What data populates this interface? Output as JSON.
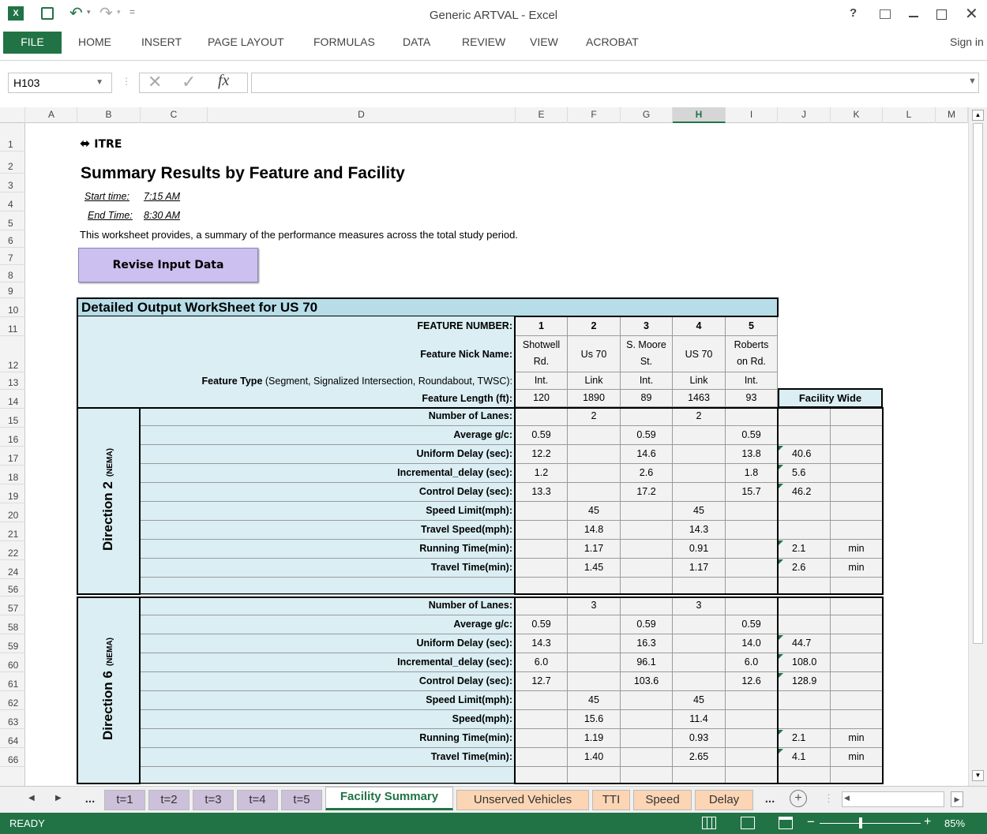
{
  "window": {
    "title": "Generic ARTVAL - Excel",
    "help": "?",
    "signin": "Sign in"
  },
  "ribbon": {
    "tabs": [
      "FILE",
      "HOME",
      "INSERT",
      "PAGE LAYOUT",
      "FORMULAS",
      "DATA",
      "REVIEW",
      "VIEW",
      "ACROBAT"
    ]
  },
  "formula_bar": {
    "cell_ref": "H103",
    "content": ""
  },
  "columns": [
    "A",
    "B",
    "C",
    "D",
    "E",
    "F",
    "G",
    "H",
    "I",
    "J",
    "K",
    "L",
    "M"
  ],
  "rows": [
    "1",
    "2",
    "3",
    "4",
    "5",
    "6",
    "7",
    "8",
    "9",
    "10",
    "11",
    "12",
    "13",
    "14",
    "15",
    "16",
    "17",
    "18",
    "19",
    "20",
    "21",
    "22",
    "24",
    "56",
    "57",
    "58",
    "59",
    "60",
    "61",
    "62",
    "63",
    "64",
    "66"
  ],
  "header": {
    "logo": "ITRE",
    "title": "Summary Results by Feature and Facility",
    "start_label": "Start time:",
    "start_value": "7:15 AM",
    "end_label": "End Time:",
    "end_value": "8:30 AM",
    "description": "This worksheet provides, a summary of the performance measures across the total study period.",
    "revise_button": "Revise Input Data"
  },
  "table": {
    "title": "Detailed Output WorkSheet for US 70",
    "feature_number_label": "FEATURE NUMBER:",
    "feature_numbers": [
      "1",
      "2",
      "3",
      "4",
      "5"
    ],
    "nick_label": "Feature Nick Name:",
    "nicks": [
      [
        "Shotwell",
        "Rd."
      ],
      [
        "Us 70",
        ""
      ],
      [
        "S. Moore",
        "St."
      ],
      [
        "US 70",
        ""
      ],
      [
        "Roberts",
        "on Rd."
      ]
    ],
    "type_label_bold": "Feature Type",
    "type_label_rest": " (Segment, Signalized Intersection, Roundabout, TWSC):",
    "types": [
      "Int.",
      "Link",
      "Int.",
      "Link",
      "Int."
    ],
    "length_label": "Feature Length (ft):",
    "lengths": [
      "120",
      "1890",
      "89",
      "1463",
      "93"
    ],
    "facility_wide": "Facility Wide",
    "dir2": {
      "label": "Direction 2",
      "sub": "(NEMA)",
      "rows": [
        {
          "label": "Number of Lanes:",
          "v": [
            "",
            "2",
            "",
            "2",
            ""
          ],
          "fw": "",
          "unit": ""
        },
        {
          "label": "Average g/c:",
          "v": [
            "0.59",
            "",
            "0.59",
            "",
            "0.59"
          ],
          "fw": "",
          "unit": ""
        },
        {
          "label": "Uniform Delay (sec):",
          "v": [
            "12.2",
            "",
            "14.6",
            "",
            "13.8"
          ],
          "fw": "40.6",
          "unit": ""
        },
        {
          "label": "Incremental_delay (sec):",
          "v": [
            "1.2",
            "",
            "2.6",
            "",
            "1.8"
          ],
          "fw": "5.6",
          "unit": ""
        },
        {
          "label": "Control Delay (sec):",
          "v": [
            "13.3",
            "",
            "17.2",
            "",
            "15.7"
          ],
          "fw": "46.2",
          "unit": ""
        },
        {
          "label": "Speed Limit(mph):",
          "v": [
            "",
            "45",
            "",
            "45",
            ""
          ],
          "fw": "",
          "unit": ""
        },
        {
          "label": "Travel Speed(mph):",
          "v": [
            "",
            "14.8",
            "",
            "14.3",
            ""
          ],
          "fw": "",
          "unit": ""
        },
        {
          "label": "Running Time(min):",
          "v": [
            "",
            "1.17",
            "",
            "0.91",
            ""
          ],
          "fw": "2.1",
          "unit": "min"
        },
        {
          "label": "Travel Time(min):",
          "v": [
            "",
            "1.45",
            "",
            "1.17",
            ""
          ],
          "fw": "2.6",
          "unit": "min"
        },
        {
          "label": "",
          "v": [
            "",
            "",
            "",
            "",
            ""
          ],
          "fw": "",
          "unit": ""
        }
      ]
    },
    "dir6": {
      "label": "Direction 6",
      "sub": "(NEMA)",
      "rows": [
        {
          "label": "Number of Lanes:",
          "v": [
            "",
            "3",
            "",
            "3",
            ""
          ],
          "fw": "",
          "unit": ""
        },
        {
          "label": "Average g/c:",
          "v": [
            "0.59",
            "",
            "0.59",
            "",
            "0.59"
          ],
          "fw": "",
          "unit": ""
        },
        {
          "label": "Uniform Delay (sec):",
          "v": [
            "14.3",
            "",
            "16.3",
            "",
            "14.0"
          ],
          "fw": "44.7",
          "unit": ""
        },
        {
          "label": "Incremental_delay (sec):",
          "v": [
            "6.0",
            "",
            "96.1",
            "",
            "6.0"
          ],
          "fw": "108.0",
          "unit": ""
        },
        {
          "label": "Control Delay (sec):",
          "v": [
            "12.7",
            "",
            "103.6",
            "",
            "12.6"
          ],
          "fw": "128.9",
          "unit": ""
        },
        {
          "label": "Speed Limit(mph):",
          "v": [
            "",
            "45",
            "",
            "45",
            ""
          ],
          "fw": "",
          "unit": ""
        },
        {
          "label": "Speed(mph):",
          "v": [
            "",
            "15.6",
            "",
            "11.4",
            ""
          ],
          "fw": "",
          "unit": ""
        },
        {
          "label": "Running Time(min):",
          "v": [
            "",
            "1.19",
            "",
            "0.93",
            ""
          ],
          "fw": "2.1",
          "unit": "min"
        },
        {
          "label": "Travel Time(min):",
          "v": [
            "",
            "1.40",
            "",
            "2.65",
            ""
          ],
          "fw": "4.1",
          "unit": "min"
        },
        {
          "label": "",
          "v": [
            "",
            "",
            "",
            "",
            ""
          ],
          "fw": "",
          "unit": ""
        }
      ]
    }
  },
  "sheet_tabs": [
    {
      "label": "...",
      "color": "#f0f0f0"
    },
    {
      "label": "t=1",
      "color": "#ccc0da"
    },
    {
      "label": "t=2",
      "color": "#ccc0da"
    },
    {
      "label": "t=3",
      "color": "#ccc0da"
    },
    {
      "label": "t=4",
      "color": "#ccc0da"
    },
    {
      "label": "t=5",
      "color": "#ccc0da"
    },
    {
      "label": "Facility Summary",
      "color": "#ffffff"
    },
    {
      "label": "Unserved Vehicles",
      "color": "#fcd5b4"
    },
    {
      "label": "TTI",
      "color": "#fcd5b4"
    },
    {
      "label": "Speed",
      "color": "#fcd5b4"
    },
    {
      "label": "Delay",
      "color": "#fcd5b4"
    },
    {
      "label": "...",
      "color": "#f0f0f0"
    }
  ],
  "status": {
    "ready": "READY",
    "zoom": "85%"
  },
  "colors": {
    "excel_green": "#217346",
    "table_fill": "#daeef3",
    "title_fill": "#b7dde8",
    "button_fill": "#ccc0f0"
  }
}
